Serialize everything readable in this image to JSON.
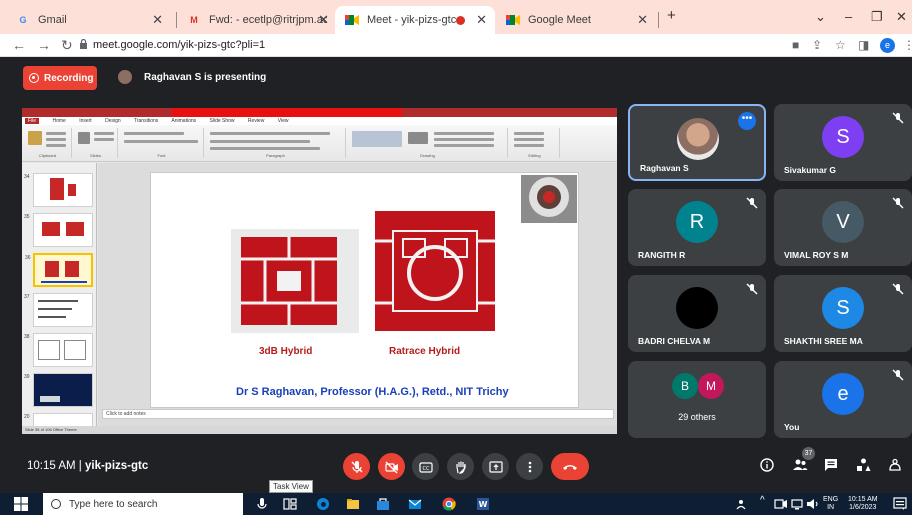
{
  "browser": {
    "tabs": [
      {
        "title": "Gmail",
        "favicon": "G",
        "active": false
      },
      {
        "title": "Fwd: - ecetlp@ritrjpm.ac.in - Ran",
        "favicon": "M",
        "active": false
      },
      {
        "title": "Meet - yik-pizs-gtc",
        "favicon": "meet",
        "active": true
      },
      {
        "title": "Google Meet",
        "favicon": "meet",
        "active": false
      }
    ],
    "new_tab_label": "+",
    "url": "meet.google.com/yik-pizs-gtc?pli=1",
    "profile_letter": "e"
  },
  "meet": {
    "recording_label": "Recording",
    "presenting_text": "Raghavan S is presenting",
    "meeting_time": "10:15 AM",
    "meeting_code": "yik-pizs-gtc",
    "participant_count": "37",
    "tooltip": "Task View",
    "tiles": [
      {
        "name": "Raghavan S",
        "type": "photo",
        "active": true
      },
      {
        "name": "Sivakumar G",
        "letter": "S",
        "color": "#7e3ff2",
        "muted": true
      },
      {
        "name": "RANGITH R",
        "letter": "R",
        "color": "#00838f",
        "muted": true
      },
      {
        "name": "VIMAL ROY S M",
        "letter": "V",
        "color": "#455a64",
        "muted": true
      },
      {
        "name": "BADRI CHELVA M",
        "letter": "",
        "color": "#000000",
        "muted": true
      },
      {
        "name": "SHAKTHI SREE MA",
        "letter": "S",
        "color": "#1e88e5",
        "muted": true
      },
      {
        "name": "29 others",
        "letters": [
          "B",
          "M"
        ],
        "colors": [
          "#00796b",
          "#c2185b"
        ],
        "muted": false
      },
      {
        "name": "You",
        "letter": "e",
        "color": "#1a73e8",
        "muted": true
      }
    ]
  },
  "slide": {
    "caption_left": "3dB Hybrid",
    "caption_right": "Ratrace Hybrid",
    "footer": "Dr S Raghavan, Professor (H.A.G.), Retd., NIT Trichy",
    "notes_placeholder": "Click to add notes",
    "ppt_tabs": [
      "File",
      "Home",
      "Insert",
      "Design",
      "Transitions",
      "Animations",
      "Slide Show",
      "Review",
      "View"
    ],
    "ribbon_groups": [
      "Clipboard",
      "Slides",
      "Font",
      "Paragraph",
      "Drawing",
      "Editing"
    ],
    "thumb_numbers": [
      "34",
      "35",
      "36",
      "37",
      "38",
      "39",
      "20"
    ],
    "status": "Slide 36 of 106   Office Theme"
  },
  "taskbar": {
    "search_placeholder": "Type here to search",
    "lang": "ENG",
    "region": "IN",
    "time": "10:15 AM",
    "date": "1/6/2023"
  }
}
